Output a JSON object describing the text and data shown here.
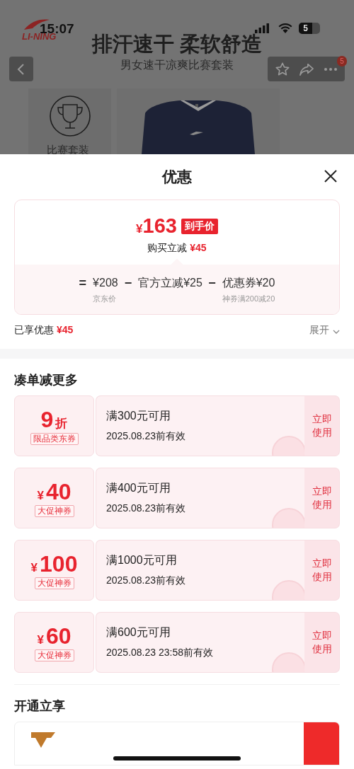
{
  "status_bar": {
    "time": "15:07",
    "battery": "5"
  },
  "background_page": {
    "brand": "LI-NING",
    "banner_title": "排汗速干 柔软舒造",
    "subtitle": "男女速干凉爽比赛套装",
    "menu_badge": "5",
    "category": "比赛套装"
  },
  "sheet": {
    "title": "优惠"
  },
  "price_card": {
    "currency": "¥",
    "final_price": "163",
    "final_tag": "到手价",
    "saving_label": "购买立减",
    "saving": "¥45",
    "formula": [
      {
        "kind": "operator",
        "text": "="
      },
      {
        "kind": "term",
        "value": "¥208",
        "note": "京东价"
      },
      {
        "kind": "operator",
        "text": "−"
      },
      {
        "kind": "term",
        "value": "官方立减¥25"
      },
      {
        "kind": "operator",
        "text": "−"
      },
      {
        "kind": "term",
        "value": "优惠券¥20",
        "note": "神券满200减20"
      }
    ]
  },
  "enjoyed": {
    "label": "已享优惠",
    "amount": "¥45"
  },
  "expand": {
    "label": "展开",
    "expanded": false
  },
  "coupon_section": {
    "title": "凑单减更多",
    "coupons": [
      {
        "kind": "discount",
        "value": "9",
        "unit": "折",
        "tag": "限品类东券",
        "condition": "满300元可用",
        "validity": "2025.08.23前有效",
        "action": "立即使用",
        "claimed": true
      },
      {
        "kind": "amount",
        "currency": "¥",
        "value": "40",
        "tag": "大促神券",
        "condition": "满400元可用",
        "validity": "2025.08.23前有效",
        "action": "立即使用",
        "claimed": true
      },
      {
        "kind": "amount",
        "currency": "¥",
        "value": "100",
        "tag": "大促神券",
        "condition": "满1000元可用",
        "validity": "2025.08.23前有效",
        "action": "立即使用",
        "claimed": true
      },
      {
        "kind": "amount",
        "currency": "¥",
        "value": "60",
        "tag": "大促神券",
        "condition": "满600元可用",
        "validity": "2025.08.23 23:58前有效",
        "action": "立即使用",
        "claimed": true
      }
    ]
  },
  "member_section": {
    "title": "开通立享"
  }
}
